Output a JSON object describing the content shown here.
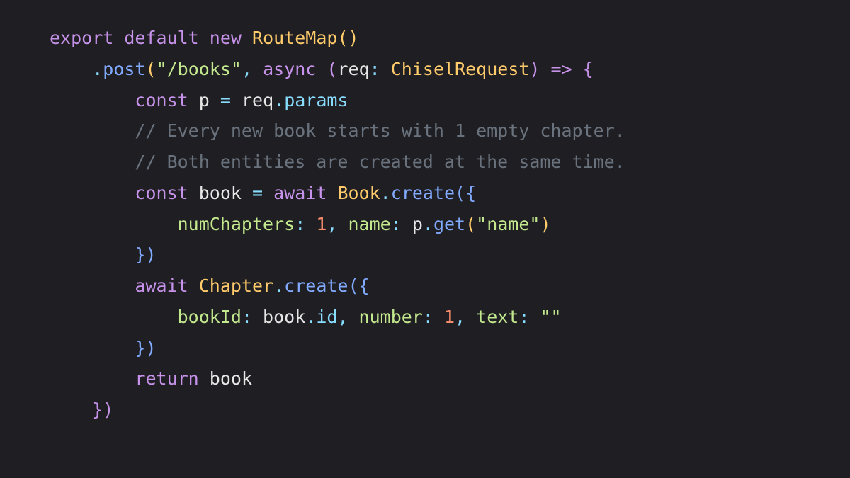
{
  "code": {
    "tokens": {
      "kw_export": "export",
      "kw_default": "default",
      "kw_new": "new",
      "cls_RouteMap": "RouteMap",
      "empty_args": "()",
      "dot": ".",
      "m_post": "post",
      "lp1": "(",
      "str_books": "\"/books\"",
      "comma_sp": ", ",
      "kw_async": "async",
      "sp": " ",
      "lp2": "(",
      "id_req": "req",
      "colon_sp": ": ",
      "cls_ChiselRequest": "ChiselRequest",
      "rp2": ")",
      "arrow": " => ",
      "lb1": "{",
      "kw_const": "const",
      "id_p": "p",
      "eq": " = ",
      "prop_params": "params",
      "comment1": "// Every new book starts with 1 empty chapter.",
      "comment2": "// Both entities are created at the same time.",
      "id_book": "book",
      "kw_await": "await",
      "cls_Book": "Book",
      "m_create": "create",
      "lb2": "({",
      "key_numChapters": "numChapters",
      "num_1": "1",
      "key_name": "name",
      "m_get": "get",
      "str_name": "\"name\"",
      "rb2": "})",
      "cls_Chapter": "Chapter",
      "key_bookId": "bookId",
      "prop_id": "id",
      "key_number": "number",
      "key_text": "text",
      "str_empty": "\"\"",
      "kw_return": "return",
      "rb1": "})"
    }
  }
}
